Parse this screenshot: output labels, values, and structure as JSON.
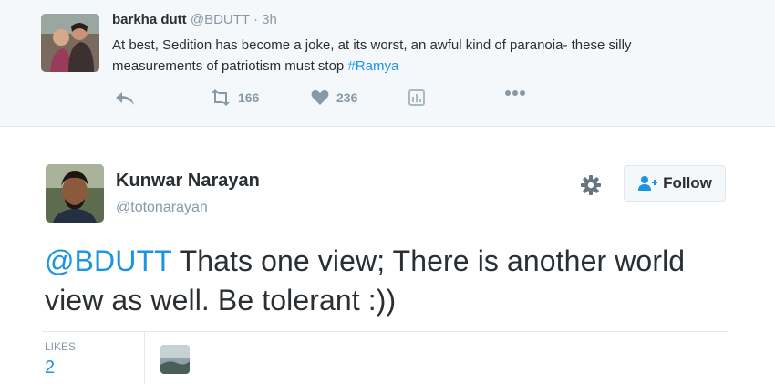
{
  "parent_tweet": {
    "name": "barkha dutt",
    "handle": "@BDUTT",
    "separator": "·",
    "time": "3h",
    "text_main": "At best, Sedition has become a joke, at its worst, an awful kind of paranoia- these silly measurements of patriotism must stop  ",
    "hashtag": "#Ramya",
    "retweet_count": "166",
    "like_count": "236",
    "icons": [
      "reply-icon",
      "retweet-icon",
      "heart-icon",
      "analytics-icon",
      "more-icon"
    ]
  },
  "main_tweet": {
    "name": "Kunwar Narayan",
    "handle": "@totonarayan",
    "follow_label": "Follow",
    "mention": "@BDUTT",
    "text": " Thats one view;  There is another world view as well. Be tolerant :))",
    "likes_label": "LIKES",
    "likes_count": "2",
    "icons": [
      "gear-icon",
      "follow-user-icon"
    ]
  },
  "colors": {
    "link_blue": "#1b95e0",
    "text_dark": "#292f33",
    "text_muted": "#8899a6",
    "parent_bg": "#f5f8fa",
    "border": "#e1e8ed"
  }
}
